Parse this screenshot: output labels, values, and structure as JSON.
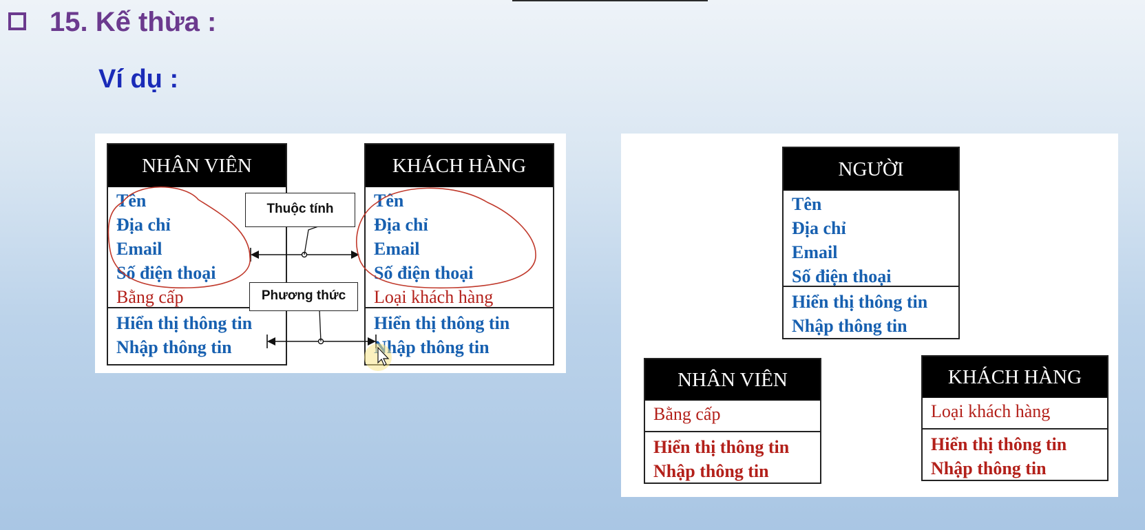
{
  "heading": {
    "number_title": "15. Kế thừa :"
  },
  "subheading": "Ví dụ :",
  "left_diagram": {
    "nhan_vien": {
      "title": "NHÂN VIÊN",
      "attributes": [
        "Tên",
        "Địa chỉ",
        "Email",
        "Số điện thoại"
      ],
      "extra_attribute": "Bằng cấp",
      "methods": [
        "Hiển thị thông tin",
        "Nhập thông tin"
      ]
    },
    "khach_hang": {
      "title": "KHÁCH HÀNG",
      "attributes": [
        "Tên",
        "Địa chỉ",
        "Email",
        "Số điện thoại"
      ],
      "extra_attribute": "Loại khách hàng",
      "methods": [
        "Hiển thị thông tin",
        "Nhập thông tin"
      ]
    },
    "callouts": {
      "attribute": "Thuộc tính",
      "method": "Phương thức"
    }
  },
  "right_diagram": {
    "nguoi": {
      "title": "NGƯỜI",
      "attributes": [
        "Tên",
        "Địa chỉ",
        "Email",
        "Số điện thoại"
      ],
      "methods": [
        "Hiển thị thông tin",
        "Nhập thông tin"
      ]
    },
    "nhan_vien": {
      "title": "NHÂN VIÊN",
      "attributes": [
        "Bằng cấp"
      ],
      "methods": [
        "Hiển thị thông tin",
        "Nhập thông tin"
      ]
    },
    "khach_hang": {
      "title": "KHÁCH HÀNG",
      "attributes": [
        "Loại khách hàng"
      ],
      "methods": [
        "Hiển thị thông tin",
        "Nhập thông tin"
      ]
    }
  },
  "colors": {
    "heading": "#6b3a8e",
    "subheading": "#1a2bb8",
    "blue_text": "#1760b0",
    "red_text": "#b3201a",
    "annotation": "#c0392b"
  },
  "icons": [
    "checkbox-square-icon",
    "mouse-cursor-icon"
  ]
}
